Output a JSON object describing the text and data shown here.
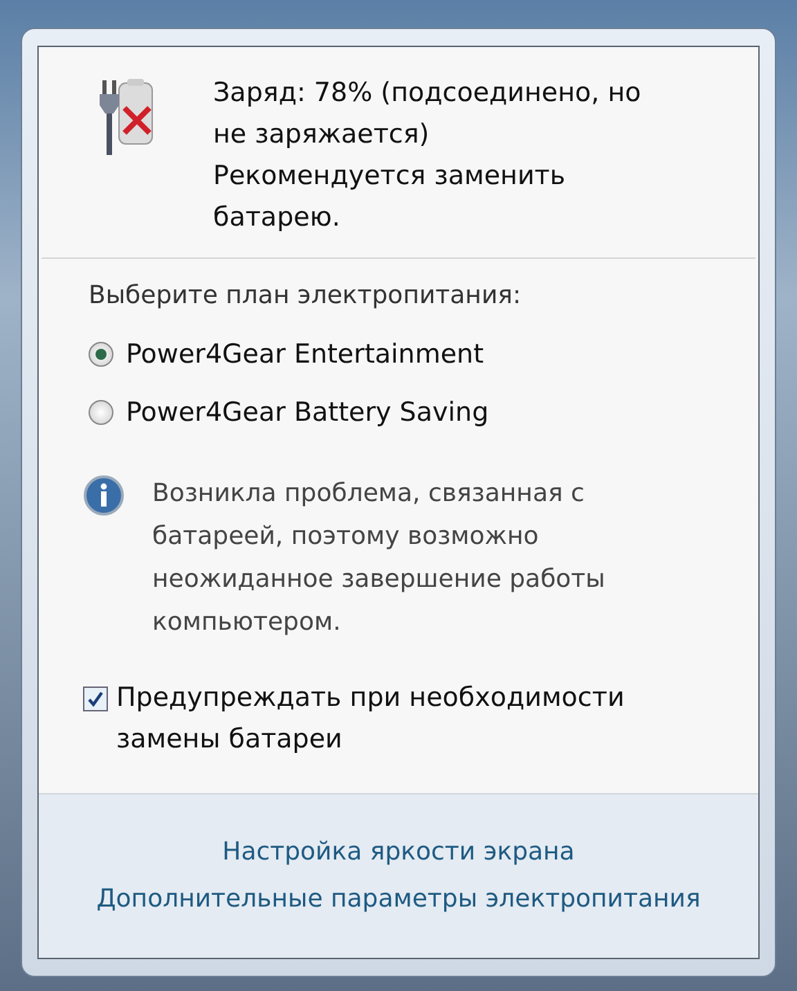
{
  "battery_status": {
    "charge": "Заряд: 78% (подсоединено, но не заряжается)",
    "recommendation": "Рекомендуется заменить батарею."
  },
  "power_plan": {
    "label": "Выберите план электропитания:",
    "options": [
      {
        "label": "Power4Gear Entertainment",
        "selected": true
      },
      {
        "label": "Power4Gear Battery Saving",
        "selected": false
      }
    ]
  },
  "info_message": "Возникла проблема, связанная с батареей, поэтому возможно неожиданное завершение работы компьютером.",
  "warn_checkbox": {
    "label": "Предупреждать при необходимости замены батареи",
    "checked": true
  },
  "links": [
    "Настройка яркости экрана",
    "Дополнительные параметры электропитания"
  ]
}
